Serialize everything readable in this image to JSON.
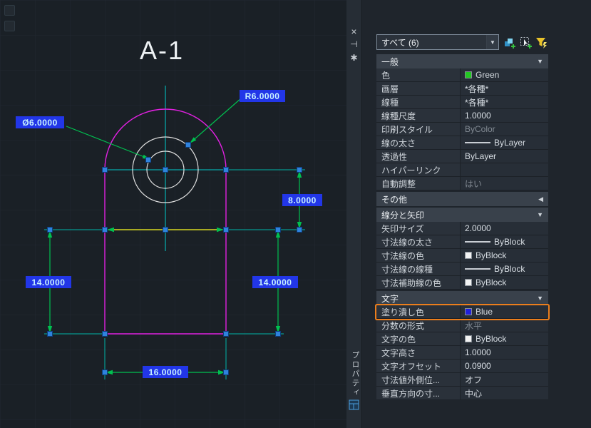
{
  "canvas": {
    "title": "A-1",
    "labels": {
      "radius": "R6.0000",
      "diameter": "Ø6.0000",
      "height8": "8.0000",
      "left14": "14.0000",
      "right14": "14.0000",
      "width16": "16.0000"
    },
    "colors": {
      "outline": "#e020e0",
      "centerline": "#00cccc",
      "dimension": "#00c050",
      "selected_line": "#d8d820",
      "grip": "#2f82dd",
      "label_fill": "#2236e8",
      "label_text": "#c9f2ff"
    }
  },
  "palette": {
    "title": "プロパティ",
    "rail_icons": {
      "close": "×",
      "autohide": "⊣",
      "settings": "✱"
    },
    "selector": {
      "value": "すべて (6)",
      "arrow": "▼"
    },
    "sections": [
      {
        "title": "一般",
        "collapsed": false,
        "rows": [
          {
            "label": "色",
            "value": "Green",
            "swatch": "#22c922"
          },
          {
            "label": "画層",
            "value": "*各種*"
          },
          {
            "label": "線種",
            "value": "*各種*"
          },
          {
            "label": "線種尺度",
            "value": "1.0000"
          },
          {
            "label": "印刷スタイル",
            "value": "ByColor",
            "muted": true
          },
          {
            "label": "線の太さ",
            "value": "ByLayer",
            "line": true
          },
          {
            "label": "透過性",
            "value": "ByLayer"
          },
          {
            "label": "ハイパーリンク",
            "value": ""
          },
          {
            "label": "自動調整",
            "value": "はい",
            "muted": true
          }
        ]
      },
      {
        "title": "その他",
        "collapsed": true,
        "rows": []
      },
      {
        "title": "線分と矢印",
        "collapsed": false,
        "rows": [
          {
            "label": "矢印サイズ",
            "value": "2.0000"
          },
          {
            "label": "寸法線の太さ",
            "value": "ByBlock",
            "line": true
          },
          {
            "label": "寸法線の色",
            "value": "ByBlock",
            "swatch": "#f2f2f2"
          },
          {
            "label": "寸法線の線種",
            "value": "ByBlock",
            "line": true
          },
          {
            "label": "寸法補助線の色",
            "value": "ByBlock",
            "swatch": "#f2f2f2"
          }
        ]
      },
      {
        "title": "文字",
        "collapsed": false,
        "rows": [
          {
            "label": "塗り潰し色",
            "value": "Blue",
            "swatch": "#2020dd",
            "highlight": true
          },
          {
            "label": "分数の形式",
            "value": "水平",
            "muted": true
          },
          {
            "label": "文字の色",
            "value": "ByBlock",
            "swatch": "#f2f2f2"
          },
          {
            "label": "文字高さ",
            "value": "1.0000"
          },
          {
            "label": "文字オフセット",
            "value": "0.0900"
          },
          {
            "label": "寸法値外側位...",
            "value": "オフ"
          },
          {
            "label": "垂直方向の寸...",
            "value": "中心"
          }
        ]
      }
    ]
  }
}
